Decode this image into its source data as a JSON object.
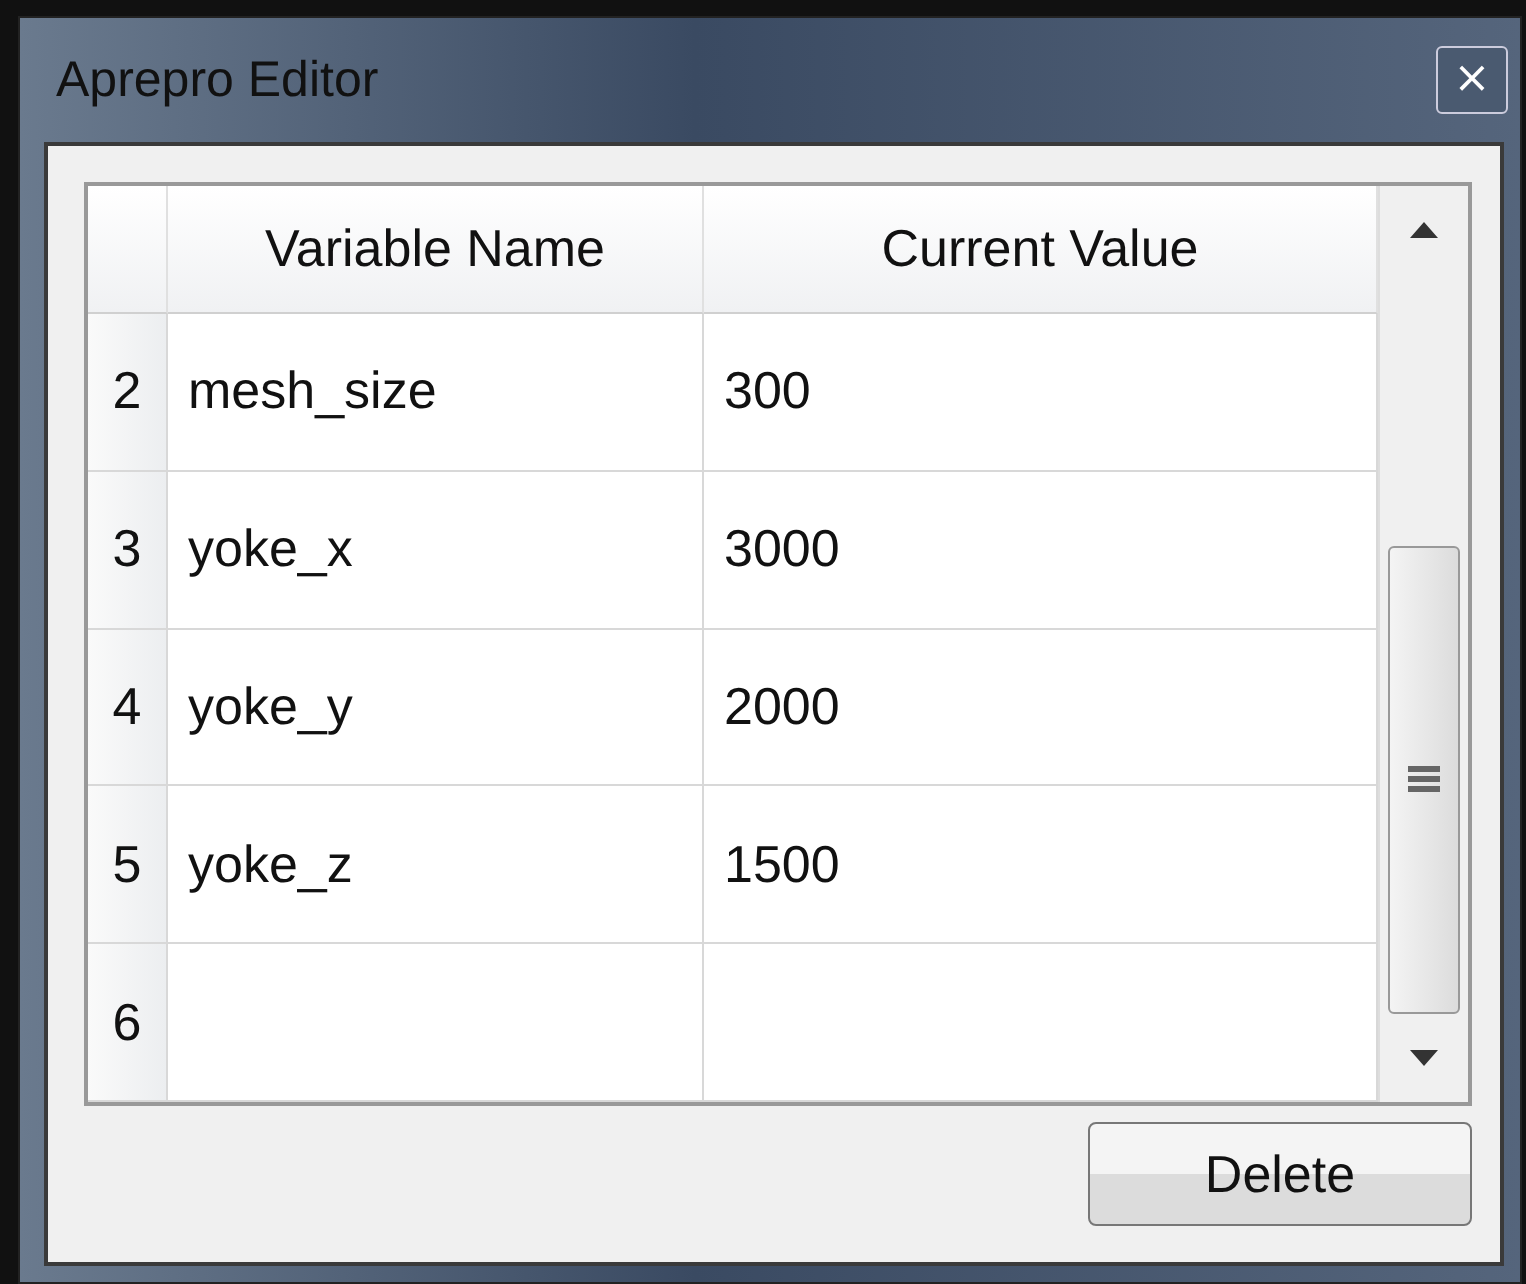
{
  "window": {
    "title": "Aprepro Editor",
    "close": "×"
  },
  "table": {
    "columns": [
      "Variable Name",
      "Current Value"
    ],
    "rows": [
      {
        "number": "2",
        "name": "mesh_size",
        "value": "300"
      },
      {
        "number": "3",
        "name": "yoke_x",
        "value": "3000"
      },
      {
        "number": "4",
        "name": "yoke_y",
        "value": "2000"
      },
      {
        "number": "5",
        "name": "yoke_z",
        "value": "1500"
      },
      {
        "number": "6"
      }
    ]
  },
  "buttons": [
    "Delete"
  ]
}
